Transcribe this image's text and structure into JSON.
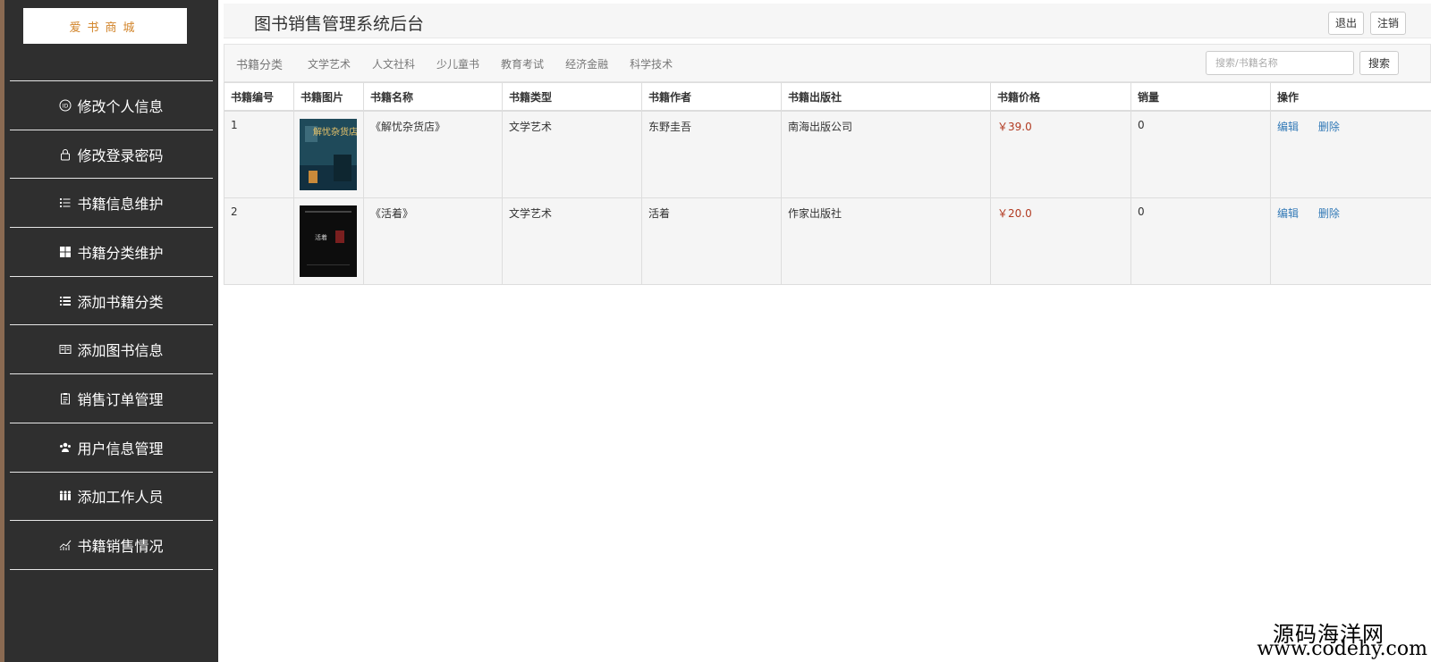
{
  "sidebar": {
    "logo": "爱书商城",
    "items": [
      {
        "label": "修改个人信息",
        "icon": "user-card-icon"
      },
      {
        "label": "修改登录密码",
        "icon": "lock-icon"
      },
      {
        "label": "书籍信息维护",
        "icon": "list-icon"
      },
      {
        "label": "书籍分类维护",
        "icon": "grid-icon"
      },
      {
        "label": "添加书籍分类",
        "icon": "list-icon"
      },
      {
        "label": "添加图书信息",
        "icon": "book-open-icon"
      },
      {
        "label": "销售订单管理",
        "icon": "clipboard-icon"
      },
      {
        "label": "用户信息管理",
        "icon": "users-icon"
      },
      {
        "label": "添加工作人员",
        "icon": "group-icon"
      },
      {
        "label": "书籍销售情况",
        "icon": "chart-icon"
      }
    ]
  },
  "header": {
    "title": "图书销售管理系统后台",
    "logout_label": "退出",
    "cancel_label": "注销"
  },
  "catnav": {
    "brand": "书籍分类",
    "links": [
      "文学艺术",
      "人文社科",
      "少儿童书",
      "教育考试",
      "经济金融",
      "科学技术"
    ],
    "search_placeholder": "搜索/书籍名称",
    "search_label": "搜索"
  },
  "table": {
    "headers": [
      "书籍编号",
      "书籍图片",
      "书籍名称",
      "书籍类型",
      "书籍作者",
      "书籍出版社",
      "书籍价格",
      "销量",
      "操作"
    ],
    "rows": [
      {
        "id": "1",
        "name": "《解忧杂货店》",
        "type": "文学艺术",
        "author": "东野圭吾",
        "publisher": "南海出版公司",
        "price": "￥39.0",
        "sales": "0",
        "edit": "编辑",
        "delete": "删除",
        "cover_text": "解忧杂货店"
      },
      {
        "id": "2",
        "name": "《活着》",
        "type": "文学艺术",
        "author": "活着",
        "publisher": "作家出版社",
        "price": "￥20.0",
        "sales": "0",
        "edit": "编辑",
        "delete": "删除",
        "cover_text": "活着"
      }
    ]
  },
  "watermark": {
    "line1": "源码海洋网",
    "line2": "www.codehy.com"
  },
  "colors": {
    "sidebar_bg": "#2f2f2f",
    "logo_text": "#d2852b",
    "price": "#b23b22",
    "link": "#337ab7"
  }
}
